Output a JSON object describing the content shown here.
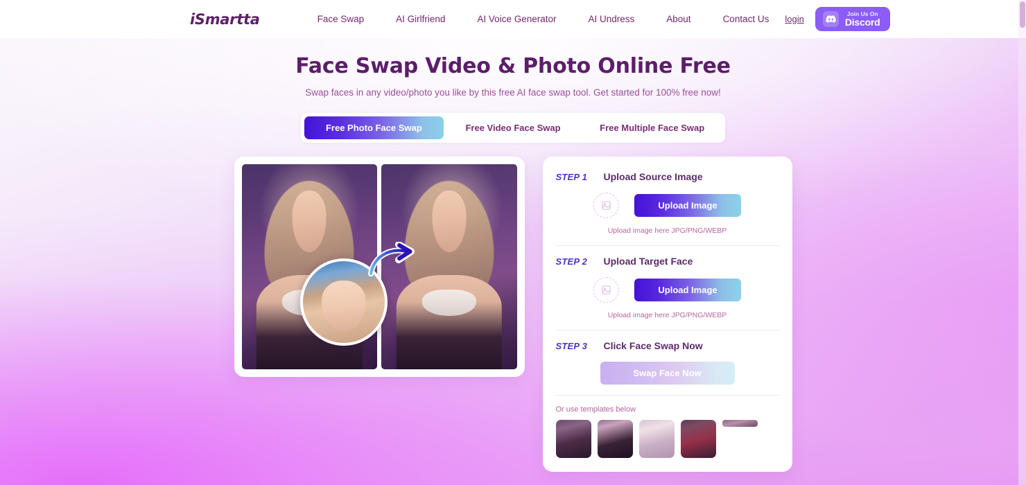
{
  "header": {
    "logo": "iSmartta",
    "nav": [
      {
        "label": "Face Swap"
      },
      {
        "label": "AI Girlfriend"
      },
      {
        "label": "AI Voice Generator"
      },
      {
        "label": "AI Undress"
      },
      {
        "label": "About"
      },
      {
        "label": "Contact Us"
      }
    ],
    "login_label": "login",
    "discord": {
      "small_label": "Join Us On",
      "big_label": "Discord",
      "icon": "discord-icon",
      "color": "#8b5cf6"
    }
  },
  "hero": {
    "title": "Face Swap Video & Photo Online Free",
    "subtitle": "Swap faces in any video/photo you like by this free AI face swap tool. Get started for 100% free now!",
    "title_color": "#5c1d6a"
  },
  "tabs": {
    "items": [
      {
        "label": "Free Photo Face Swap",
        "active": true
      },
      {
        "label": "Free Video Face Swap",
        "active": false
      },
      {
        "label": "Free Multiple Face Swap",
        "active": false
      }
    ],
    "active_gradient_from": "#4312d6",
    "active_gradient_to": "#8ad0ea"
  },
  "preview": {
    "before_alt": "before face swap photo",
    "after_alt": "after face swap photo",
    "face_bubble_alt": "source face thumbnail",
    "arrow_alt": "swap arrow"
  },
  "steps": [
    {
      "label": "STEP 1",
      "title": "Upload Source Image",
      "button_label": "Upload Image",
      "hint": "Upload image here JPG/PNG/WEBP"
    },
    {
      "label": "STEP 2",
      "title": "Upload Target Face",
      "button_label": "Upload Image",
      "hint": "Upload image here JPG/PNG/WEBP"
    },
    {
      "label": "STEP 3",
      "title": "Click Face Swap Now",
      "button_label": "Swap Face Now",
      "disabled": true
    }
  ],
  "templates": {
    "label": "Or use templates below",
    "items": [
      {
        "name": "template-1"
      },
      {
        "name": "template-2"
      },
      {
        "name": "template-3"
      },
      {
        "name": "template-4"
      },
      {
        "name": "template-5"
      }
    ]
  }
}
